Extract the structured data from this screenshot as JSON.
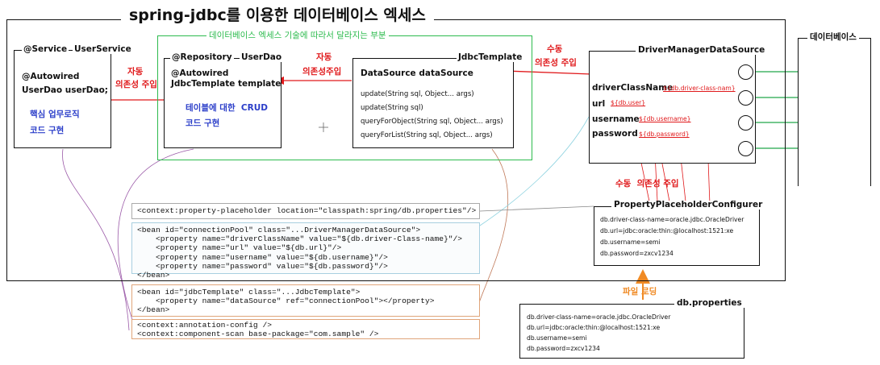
{
  "main_title": "spring-jdbc를 이용한 데이터베이스 엑세스",
  "green_group_label": "데이터베이스 엑세스 기술에 따라서 달라지는 부분",
  "service_box": {
    "stereotype": "@Service",
    "class_name": "UserService",
    "line1": "@Autowired",
    "line2": "UserDao userDao;",
    "note1": "핵심 업무로직",
    "note2": "코드 구현"
  },
  "dao_box": {
    "stereotype": "@Repository",
    "class_name": "UserDao",
    "line1": "@Autowired",
    "line2": "JdbcTemplate template",
    "note1": "테이블에 대한  CRUD",
    "note2": "코드 구현"
  },
  "template_box": {
    "class_name": "JdbcTemplate",
    "field": "DataSource dataSource",
    "methods": [
      "update(String sql, Object... args)",
      "update(String sql)",
      "queryForObject(String sql, Object... args)",
      "queryForList(String sql, Object... args)"
    ]
  },
  "datasource_box": {
    "class_name": "DriverManagerDataSource",
    "props": [
      {
        "name": "driverClassName",
        "expr": "${db.driver-class-nam}"
      },
      {
        "name": "url",
        "expr": "${db.user}"
      },
      {
        "name": "username",
        "expr": "${db.username}"
      },
      {
        "name": "password",
        "expr": "${db.password}"
      }
    ]
  },
  "database_label": "데이터베이스",
  "arrows": {
    "auto_di_1a": "자동",
    "auto_di_1b": "의존성 주입",
    "auto_di_2a": "자동",
    "auto_di_2b": "의존성주입",
    "manual_di_1a": "수동",
    "manual_di_1b": "의존성 주입",
    "manual_di_2": "수동  의존성 주입",
    "file_loading": "파일 로딩"
  },
  "placeholder_box": {
    "title": "PropertyPlaceholderConfigurer",
    "lines": [
      "db.driver-class-name=oracle.jdbc.OracleDriver",
      "db.url=jdbc:oracle:thin:@localhost:1521:xe",
      "db.username=semi",
      "db.password=zxcv1234"
    ]
  },
  "properties_box": {
    "title": "db.properties",
    "lines": [
      "db.driver-class-name=oracle.jdbc.OracleDriver",
      "db.url=jdbc:oracle:thin:@localhost:1521:xe",
      "db.username=semi",
      "db.password=zxcv1234"
    ]
  },
  "xml": {
    "placeholder": "<context:property-placeholder location=\"classpath:spring/db.properties\"/>",
    "connection_pool": "<bean id=\"connectionPool\" class=\"...DriverManagerDataSource\">\n    <property name=\"driverClassName\" value=\"${db.driver-Class-name}\"/>\n    <property name=\"url\" value=\"${db.url}\"/>\n    <property name=\"username\" value=\"${db.username}\"/>\n    <property name=\"password\" value=\"${db.password}\"/>\n</bean>",
    "jdbc_template": "<bean id=\"jdbcTemplate\" class=\"...JdbcTemplate\">\n    <property name=\"dataSource\" ref=\"connectionPool\"></property>\n</bean>",
    "annotation": "<context:annotation-config />\n<context:component-scan base-package=\"com.sample\" />"
  },
  "colors": {
    "arrow_red": "#e0191b",
    "group_green": "#2dbb4e",
    "db_link_green": "#22a84a",
    "file_arrow_orange": "#f08a24",
    "note_blue": "#2b3ec9",
    "curve_purple": "#9b5aa8",
    "curve_brown": "#c07a5a"
  }
}
